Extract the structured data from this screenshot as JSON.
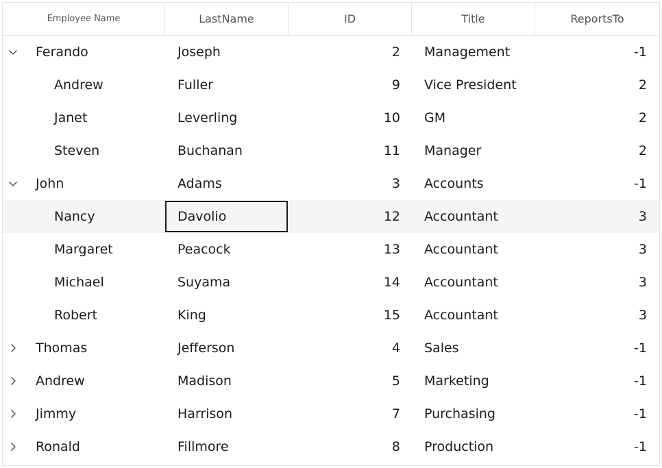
{
  "columns": [
    {
      "label": "Employee Name"
    },
    {
      "label": "LastName"
    },
    {
      "label": "ID"
    },
    {
      "label": "Title"
    },
    {
      "label": "ReportsTo"
    }
  ],
  "rows": [
    {
      "first": "Ferando",
      "last": "Joseph",
      "id": "2",
      "title": "Management",
      "reports": "-1",
      "level": 0,
      "expander": "expanded"
    },
    {
      "first": "Andrew",
      "last": "Fuller",
      "id": "9",
      "title": "Vice President",
      "reports": "2",
      "level": 1,
      "expander": "none"
    },
    {
      "first": "Janet",
      "last": "Leverling",
      "id": "10",
      "title": "GM",
      "reports": "2",
      "level": 1,
      "expander": "none"
    },
    {
      "first": "Steven",
      "last": "Buchanan",
      "id": "11",
      "title": "Manager",
      "reports": "2",
      "level": 1,
      "expander": "none"
    },
    {
      "first": "John",
      "last": "Adams",
      "id": "3",
      "title": "Accounts",
      "reports": "-1",
      "level": 0,
      "expander": "expanded"
    },
    {
      "first": "Nancy",
      "last": "Davolio",
      "id": "12",
      "title": "Accountant",
      "reports": "3",
      "level": 1,
      "expander": "none",
      "selected": true
    },
    {
      "first": "Margaret",
      "last": "Peacock",
      "id": "13",
      "title": "Accountant",
      "reports": "3",
      "level": 1,
      "expander": "none"
    },
    {
      "first": "Michael",
      "last": "Suyama",
      "id": "14",
      "title": "Accountant",
      "reports": "3",
      "level": 1,
      "expander": "none"
    },
    {
      "first": "Robert",
      "last": "King",
      "id": "15",
      "title": "Accountant",
      "reports": "3",
      "level": 1,
      "expander": "none"
    },
    {
      "first": "Thomas",
      "last": "Jefferson",
      "id": "4",
      "title": "Sales",
      "reports": "-1",
      "level": 0,
      "expander": "collapsed"
    },
    {
      "first": "Andrew",
      "last": "Madison",
      "id": "5",
      "title": "Marketing",
      "reports": "-1",
      "level": 0,
      "expander": "collapsed"
    },
    {
      "first": "Jimmy",
      "last": "Harrison",
      "id": "7",
      "title": "Purchasing",
      "reports": "-1",
      "level": 0,
      "expander": "collapsed"
    },
    {
      "first": "Ronald",
      "last": "Fillmore",
      "id": "8",
      "title": "Production",
      "reports": "-1",
      "level": 0,
      "expander": "collapsed"
    }
  ],
  "focused_cell": {
    "row": 5,
    "column": "LastName"
  },
  "colors": {
    "selected_row": "#f5f5f5",
    "grid_line": "#e3e3e3",
    "focus_border": "#1b1b1b"
  }
}
